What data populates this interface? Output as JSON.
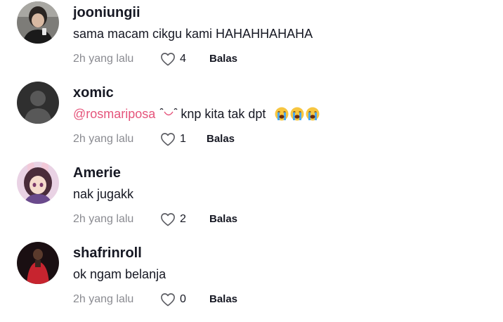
{
  "comments": [
    {
      "username": "jooniungii",
      "text": "sama macam cikgu kami HAHAHHAHAHA",
      "time": "2h yang lalu",
      "likes": "4",
      "reply": "Balas",
      "avatar_icon": "user-photo-dark"
    },
    {
      "username": "xomic",
      "mention": "@rosmariposa",
      "text": "knp kita tak dpt",
      "time": "2h yang lalu",
      "likes": "1",
      "reply": "Balas",
      "avatar_icon": "default-avatar-icon",
      "emojis": [
        "loudly-crying-face",
        "loudly-crying-face",
        "loudly-crying-face"
      ]
    },
    {
      "username": "Amerie",
      "text": "nak jugakk",
      "time": "2h yang lalu",
      "likes": "2",
      "reply": "Balas",
      "avatar_icon": "anime-girl-avatar"
    },
    {
      "username": "shafrinroll",
      "text": "ok ngam belanja",
      "time": "2h yang lalu",
      "likes": "0",
      "reply": "Balas",
      "avatar_icon": "user-photo-red"
    }
  ],
  "colors": {
    "mention": "#e5547b",
    "meta": "#8a8b91",
    "text": "#161823"
  }
}
